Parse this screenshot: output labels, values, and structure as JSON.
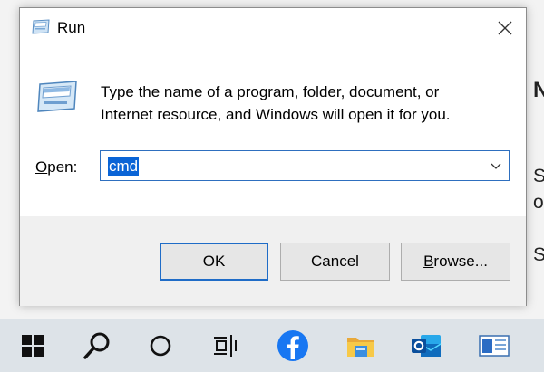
{
  "dialog": {
    "title": "Run",
    "description_line1": "Type the name of a program, folder, document, or",
    "description_line2": "Internet resource, and Windows will open it for you.",
    "open_label_accel": "O",
    "open_label_rest": "pen:",
    "open_value": "cmd",
    "buttons": {
      "ok": "OK",
      "cancel": "Cancel",
      "browse_accel": "B",
      "browse_rest": "rowse..."
    }
  },
  "background": {
    "fragments": [
      "N",
      "S",
      "o",
      "S"
    ]
  },
  "taskbar": {
    "items": [
      "windows-start-icon",
      "search-icon",
      "cortana-icon",
      "task-view-icon",
      "facebook-icon",
      "file-explorer-icon",
      "outlook-icon",
      "app-window-icon"
    ]
  },
  "colors": {
    "accent": "#0a64d6",
    "focus_border": "#1f6cc7",
    "taskbar": "#dde3e8",
    "facebook": "#1877f2",
    "outlook": "#0f6cbd"
  }
}
